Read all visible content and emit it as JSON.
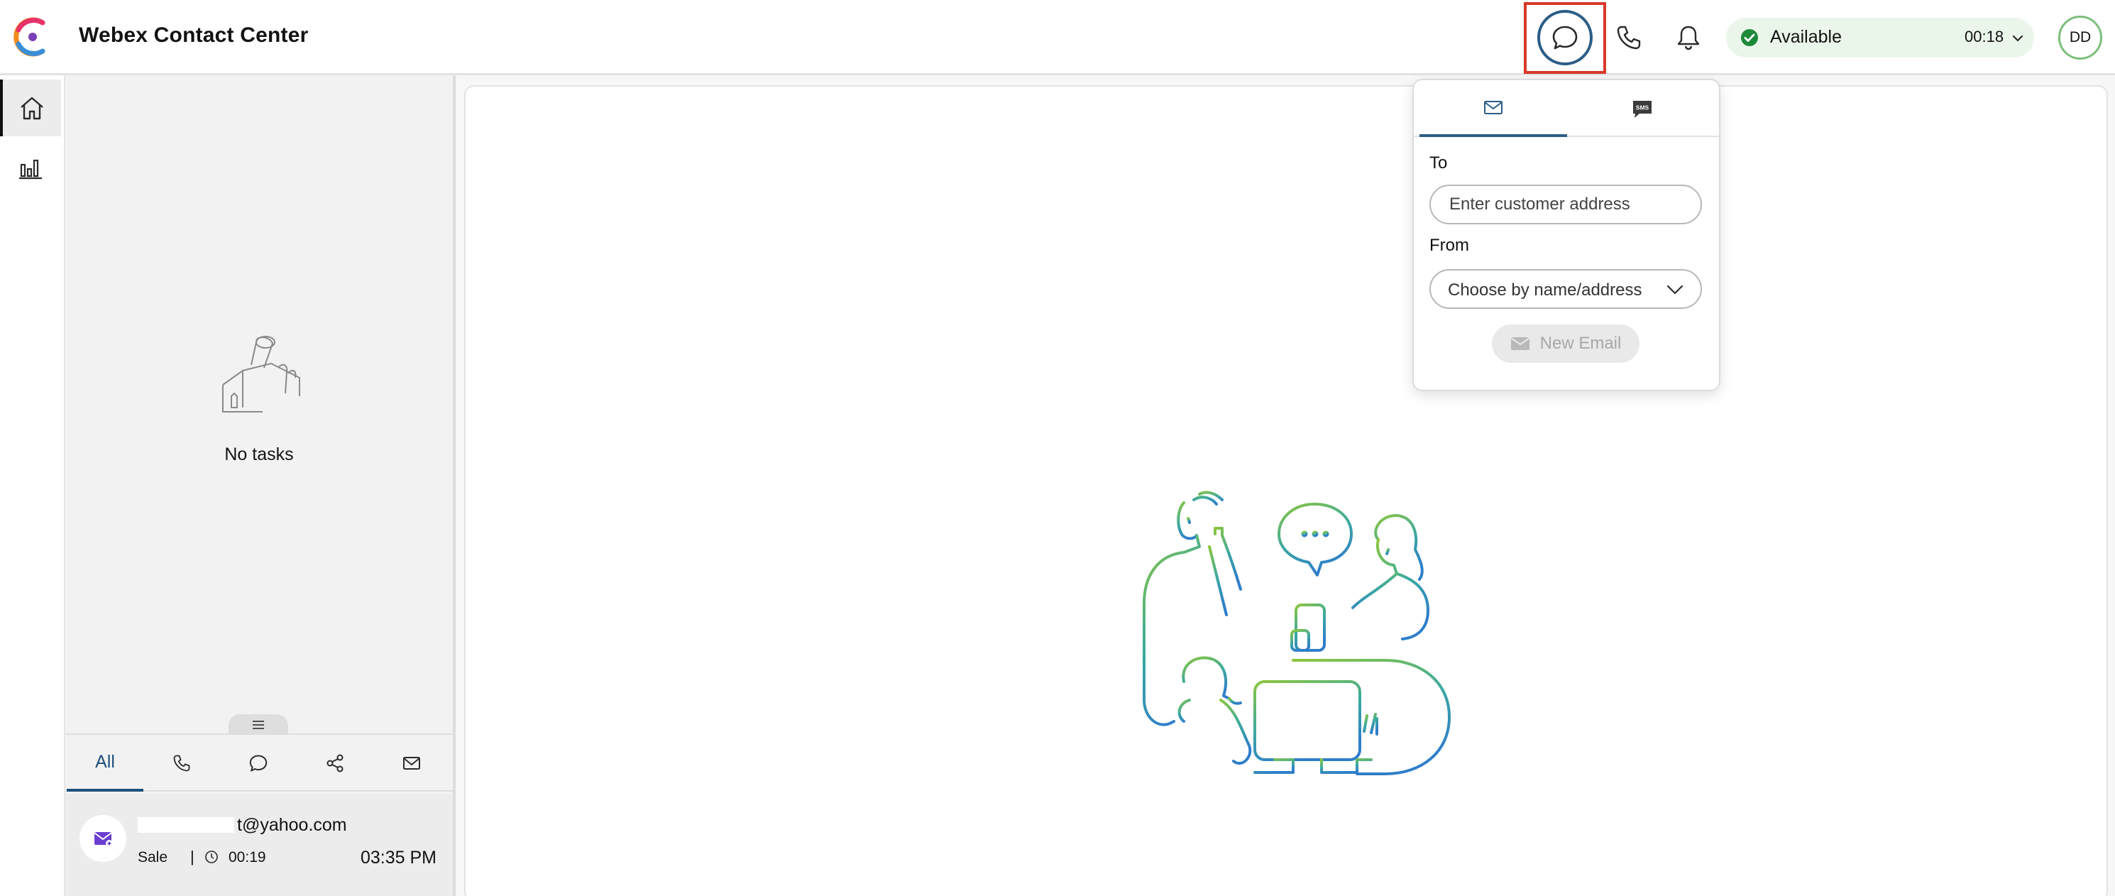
{
  "header": {
    "app_title": "Webex Contact Center",
    "icons": {
      "logo": "webex-logo",
      "outdial_chat": "chat-bubble-icon",
      "phone": "phone-icon",
      "notifications": "bell-icon"
    },
    "agent_state": {
      "label": "Available",
      "timer": "00:18",
      "status_color": "#1d8a3a"
    },
    "avatar_initials": "DD",
    "highlight_color": "#d93829"
  },
  "nav": {
    "items": [
      {
        "name": "home",
        "icon": "home-icon",
        "active": true
      },
      {
        "name": "analyzer",
        "icon": "bar-chart-icon",
        "active": false
      }
    ]
  },
  "task_panel": {
    "empty_state": "No tasks",
    "filters": [
      {
        "label": "All",
        "active": true
      },
      {
        "icon": "phone-icon"
      },
      {
        "icon": "chat-bubble-icon"
      },
      {
        "icon": "social-share-icon"
      },
      {
        "icon": "email-icon"
      }
    ],
    "tasks": [
      {
        "title_visible": "t@yahoo.com",
        "queue": "Sale",
        "separator": "|",
        "duration": "00:19",
        "time": "03:35 PM",
        "channel_icon": "email-icon"
      }
    ]
  },
  "outdial_popover": {
    "tabs": [
      {
        "icon": "email-icon",
        "active": true
      },
      {
        "icon": "sms-icon",
        "text": "SMS",
        "active": false
      }
    ],
    "to_label": "To",
    "to_placeholder": "Enter customer address",
    "from_label": "From",
    "from_value": "Choose by name/address",
    "submit_label": "New Email",
    "accent_color": "#2b5d86"
  }
}
